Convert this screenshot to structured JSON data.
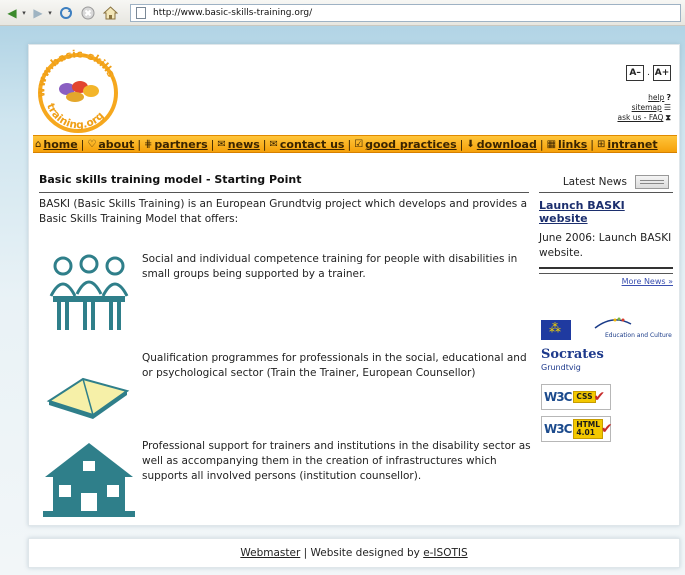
{
  "browser": {
    "url": "http://www.basic-skills-training.org/"
  },
  "header": {
    "logo_text_top": "www.basic-skills-",
    "logo_text_bottom": "training.org",
    "font_smaller": "A–",
    "font_separator": ".",
    "font_larger": "A+",
    "utility_links": [
      {
        "label": "help",
        "icon": "?"
      },
      {
        "label": "sitemap",
        "icon": "☰"
      },
      {
        "label": "ask us - FAQ",
        "icon": "⧗"
      }
    ]
  },
  "nav": [
    {
      "label": "home",
      "icon": "⌂"
    },
    {
      "label": "about",
      "icon": "♡"
    },
    {
      "label": "partners",
      "icon": "⋕"
    },
    {
      "label": "news",
      "icon": "✉"
    },
    {
      "label": "contact us",
      "icon": "✉"
    },
    {
      "label": "good practices",
      "icon": "☑"
    },
    {
      "label": "download",
      "icon": "⬇"
    },
    {
      "label": "links",
      "icon": "▦"
    },
    {
      "label": "intranet",
      "icon": "⊞"
    }
  ],
  "main": {
    "title": "Basic skills training model - Starting Point",
    "intro": "BASKI (Basic Skills Training) is an European Grundtvig project which develops and provides a Basic Skills Training Model that offers:",
    "features": [
      {
        "text": "Social and individual competence training for people with disabilities in small groups being supported by a trainer."
      },
      {
        "text": "Qualification programmes for professionals in the social, educational and or psychological sector (Train the Trainer, European Counsellor)"
      },
      {
        "text": "Professional support for trainers and institutions in the disability sector as well as accompanying them in the creation of infrastructures which supports all involved persons (institution counsellor)."
      }
    ]
  },
  "sidebar": {
    "news_heading": "Latest News",
    "news_link": "Launch BASKI website",
    "news_text": "June 2006: Launch BASKI website.",
    "more_news": "More News »",
    "eac_caption": "Education and Culture",
    "socrates": "Socrates",
    "grundtvig": "Grundtvig",
    "badges": [
      {
        "logo": "W3C",
        "tag": "CSS"
      },
      {
        "logo": "W3C",
        "tag": "HTML 4.01"
      }
    ]
  },
  "footer": {
    "webmaster": "Webmaster",
    "separator": " | Website designed by ",
    "designer": "e-ISOTIS"
  },
  "colors": {
    "nav_orange": "#f5a10a",
    "link_blue": "#1c2f6e",
    "icon_teal": "#2f7f8a"
  }
}
